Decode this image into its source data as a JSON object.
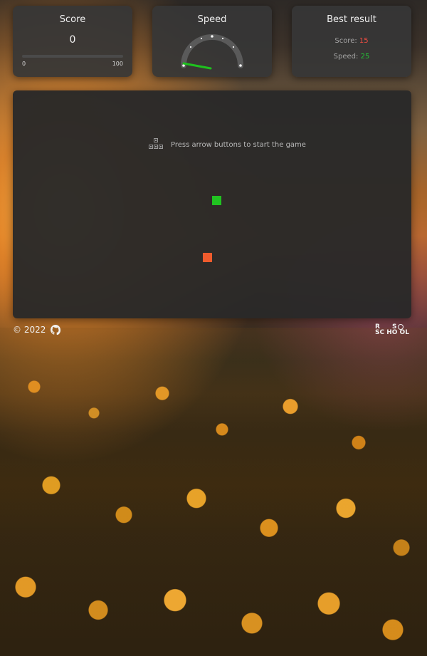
{
  "score_card": {
    "title": "Score",
    "value": "0",
    "min_label": "0",
    "max_label": "100",
    "progress_percent": 0
  },
  "speed_card": {
    "title": "Speed",
    "needle_color": "#1ec11e"
  },
  "best_result": {
    "title": "Best result",
    "score_label": "Score:",
    "score_value": "15",
    "speed_label": "Speed:",
    "speed_value": "25",
    "score_color": "#f04d42",
    "speed_color": "#25c137"
  },
  "game": {
    "hint_text": "Press arrow buttons to start the game",
    "keys_icon": "arrow-keys-icon",
    "snake_color": "#21c321",
    "food_color": "#ef5b2d"
  },
  "footer": {
    "copyright": "© 2022",
    "github_icon": "github-icon",
    "logo_text": "RS SCHOOL"
  }
}
